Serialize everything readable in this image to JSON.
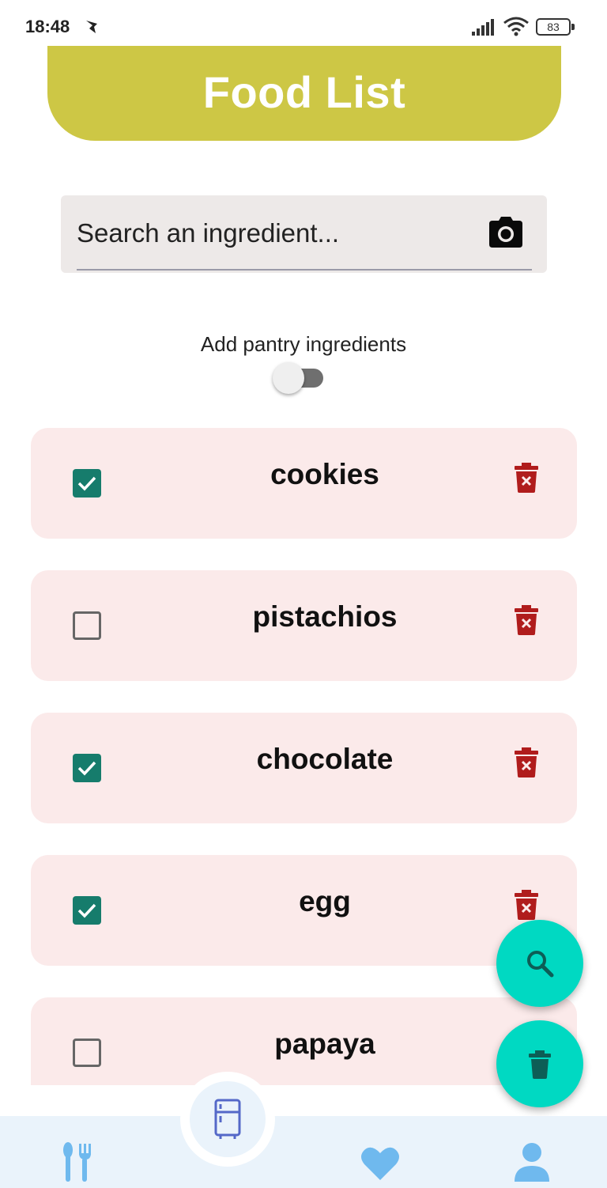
{
  "status_bar": {
    "time": "18:48",
    "battery": "83",
    "icons": [
      "notification-icon",
      "signal-icon",
      "wifi-icon",
      "battery-icon"
    ]
  },
  "header": {
    "title": "Food List"
  },
  "search": {
    "placeholder": "Search an ingredient...",
    "icon": "camera-icon"
  },
  "pantry": {
    "label": "Add pantry ingredients",
    "toggle_on": false
  },
  "items": [
    {
      "name": "cookies",
      "checked": true
    },
    {
      "name": "pistachios",
      "checked": false
    },
    {
      "name": "chocolate",
      "checked": true
    },
    {
      "name": "egg",
      "checked": true
    },
    {
      "name": "papaya",
      "checked": false
    }
  ],
  "fabs": [
    {
      "icon": "search-icon"
    },
    {
      "icon": "trash-icon"
    }
  ],
  "bottom_nav": {
    "items": [
      "fork-knife-icon",
      "fridge-icon",
      "heart-icon",
      "user-icon"
    ],
    "active": "fridge-icon"
  },
  "colors": {
    "header": "#cdc745",
    "card": "#fbeaea",
    "checkbox": "#167c6c",
    "delete": "#b01c1c",
    "fab": "#00d9c2",
    "nav": "#eaf3fb",
    "nav_icon": "#6fb9ee",
    "nav_active": "#5468c8"
  }
}
